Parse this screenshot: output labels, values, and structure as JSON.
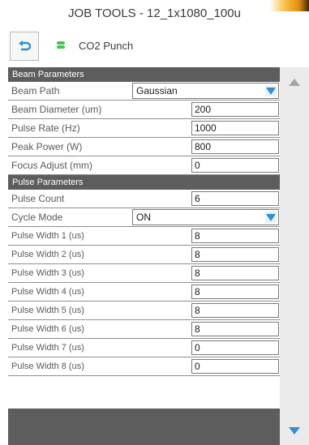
{
  "window": {
    "title": "JOB TOOLS - 12_1x1080_100u"
  },
  "toolbar": {
    "back_icon": "undo-arrow-icon",
    "status_color": "#39c85a",
    "tool_name": "CO2 Punch"
  },
  "colors": {
    "accent": "#2f8fd8",
    "header_bg": "#5d5d5d"
  },
  "sections": {
    "beam": {
      "header": "Beam Parameters",
      "beam_path": {
        "label": "Beam Path",
        "value": "Gaussian"
      },
      "beam_diameter": {
        "label": "Beam Diameter (um)",
        "value": "200"
      },
      "pulse_rate": {
        "label": "Pulse Rate (Hz)",
        "value": "1000"
      },
      "peak_power": {
        "label": "Peak Power (W)",
        "value": "800"
      },
      "focus_adjust": {
        "label": "Focus Adjust (mm)",
        "value": "0"
      }
    },
    "pulse": {
      "header": "Pulse Parameters",
      "pulse_count": {
        "label": "Pulse Count",
        "value": "6"
      },
      "cycle_mode": {
        "label": "Cycle Mode",
        "value": "ON"
      },
      "widths": [
        {
          "label": "Pulse Width 1 (us)",
          "value": "8"
        },
        {
          "label": "Pulse Width 2 (us)",
          "value": "8"
        },
        {
          "label": "Pulse Width 3 (us)",
          "value": "8"
        },
        {
          "label": "Pulse Width 4 (us)",
          "value": "8"
        },
        {
          "label": "Pulse Width 5 (us)",
          "value": "8"
        },
        {
          "label": "Pulse Width 6 (us)",
          "value": "8"
        },
        {
          "label": "Pulse Width 7 (us)",
          "value": "0"
        },
        {
          "label": "Pulse Width 8 (us)",
          "value": "0"
        }
      ]
    }
  }
}
